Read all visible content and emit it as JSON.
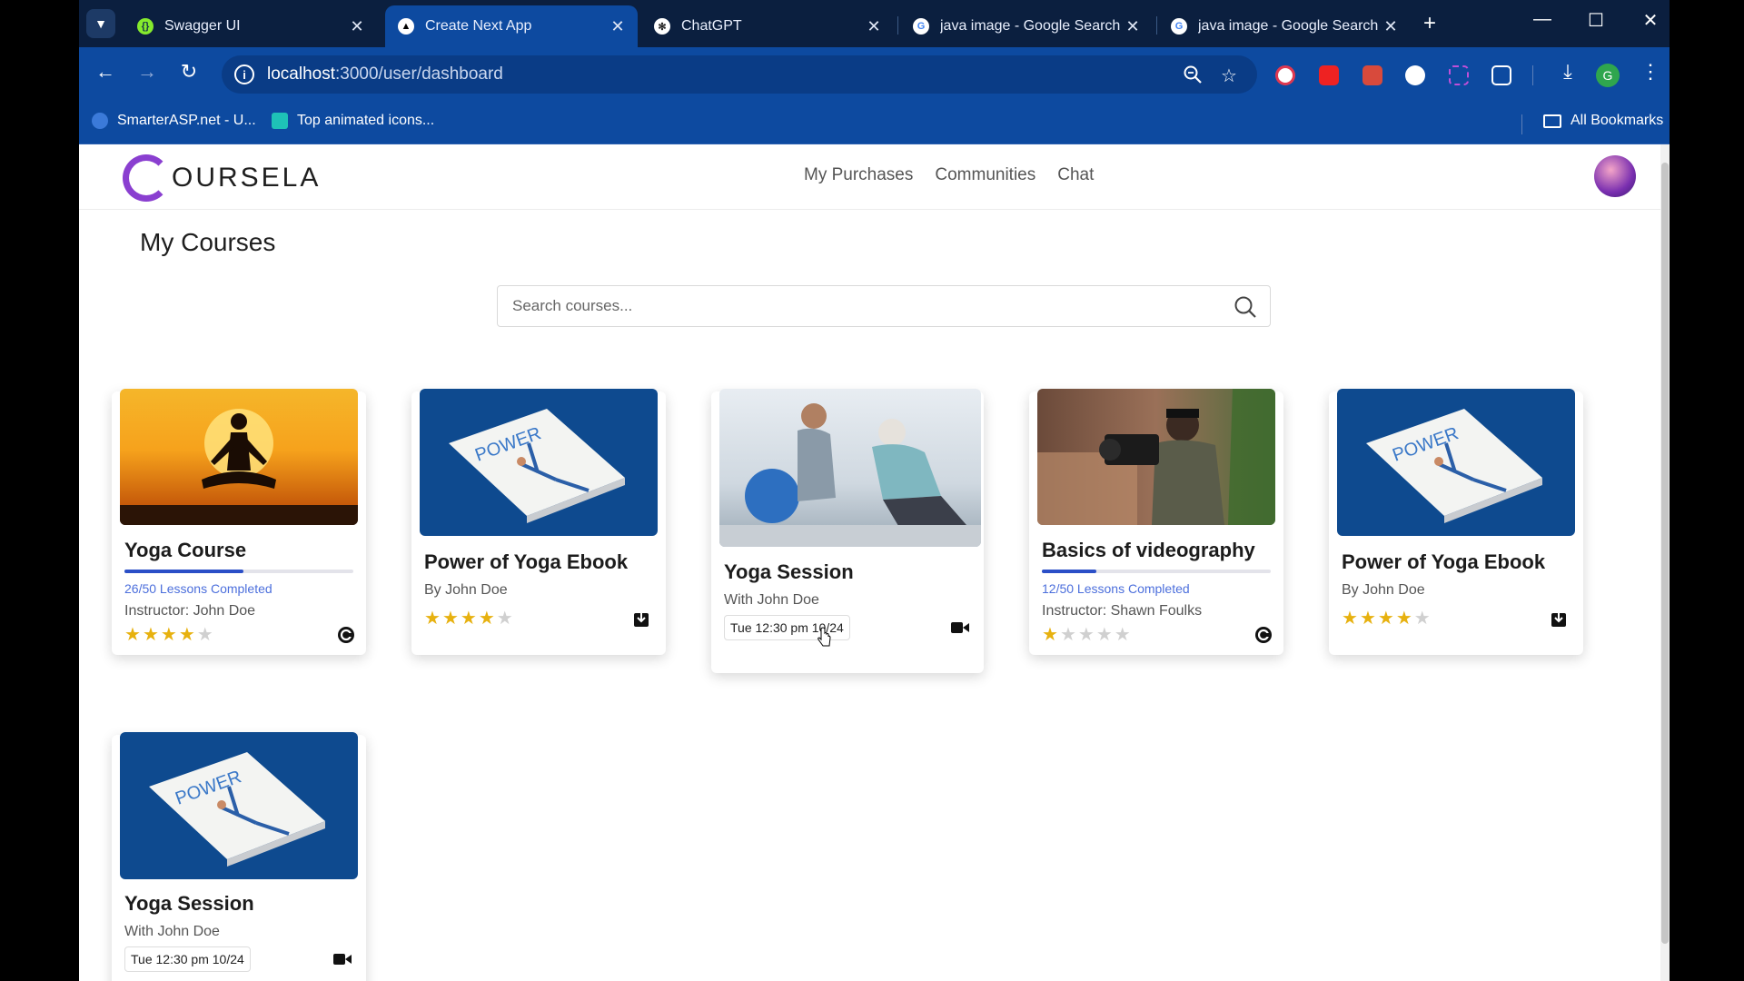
{
  "browser": {
    "tabs": [
      {
        "label": "Swagger UI",
        "icon": "swagger-icon",
        "active": false
      },
      {
        "label": "Create Next App",
        "icon": "nextjs-icon",
        "active": true
      },
      {
        "label": "ChatGPT",
        "icon": "chatgpt-icon",
        "active": false
      },
      {
        "label": "java image - Google Search",
        "icon": "google-icon",
        "active": false
      },
      {
        "label": "java image - Google Search",
        "icon": "google-icon",
        "active": false
      }
    ],
    "url_host": "localhost",
    "url_path": ":3000/user/dashboard",
    "bookmarks": [
      {
        "label": "SmarterASP.net - U...",
        "icon": "smarterasp-icon"
      },
      {
        "label": "Top animated icons...",
        "icon": "vuetify-icon"
      }
    ],
    "all_bookmarks": "All Bookmarks",
    "profile_letter": "G"
  },
  "app": {
    "logo_text": "OURSELA",
    "nav": [
      "My Purchases",
      "Communities",
      "Chat"
    ],
    "page_title": "My Courses",
    "search_placeholder": "Search courses..."
  },
  "colors": {
    "accent": "#2b4fc7",
    "star": "#e7b10f",
    "tabstrip": "#0b1f3f",
    "toolbar": "#0d4aa0"
  },
  "cards": [
    {
      "title": "Yoga Course",
      "type": "course",
      "progress": 0.52,
      "lessons": "26/50 Lessons Completed",
      "instructor": "Instructor: John Doe",
      "rating": 4,
      "badge_icon": "course-badge-icon",
      "image": "yoga-sunset-image"
    },
    {
      "title": "Power of Yoga Ebook",
      "type": "ebook",
      "author": "By John Doe",
      "rating": 4,
      "badge_icon": "download-icon",
      "image": "yoga-book-image"
    },
    {
      "title": "Yoga Session",
      "type": "session",
      "with": "With John Doe",
      "date": "Tue 12:30 pm 10/24",
      "badge_icon": "video-camera-icon",
      "image": "physio-session-image"
    },
    {
      "title": "Basics of videography",
      "type": "course",
      "progress": 0.24,
      "lessons": "12/50 Lessons Completed",
      "instructor": "Instructor: Shawn Foulks",
      "rating": 1,
      "badge_icon": "course-badge-icon",
      "image": "videographer-image"
    },
    {
      "title": "Power of Yoga Ebook",
      "type": "ebook",
      "author": "By John Doe",
      "rating": 4,
      "badge_icon": "download-icon",
      "image": "yoga-book-image"
    },
    {
      "title": "Yoga Session",
      "type": "session",
      "with": "With John Doe",
      "date": "Tue 12:30 pm 10/24",
      "badge_icon": "video-camera-icon",
      "image": "yoga-book-image"
    }
  ]
}
